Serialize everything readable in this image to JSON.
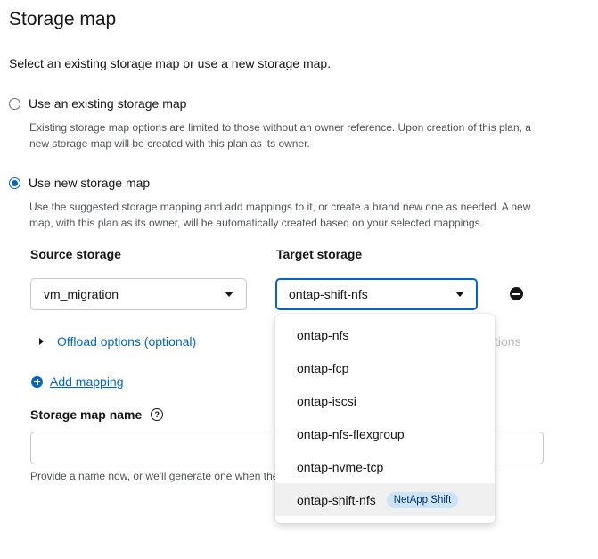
{
  "page": {
    "title": "Storage map",
    "subtitle": "Select an existing storage map or use a new storage map."
  },
  "options": {
    "existing": {
      "label": "Use an existing storage map",
      "description": "Existing storage map options are limited to those without an owner reference. Upon creation of this plan, a new storage map will be created with this plan as its owner.",
      "checked": false
    },
    "new": {
      "label": "Use new storage map",
      "description": "Use the suggested storage mapping and add mappings to it, or create a brand new one as needed. A new map, with this plan as its owner, will be automatically created based on your selected mappings.",
      "checked": true
    }
  },
  "mapping": {
    "source_label": "Source storage",
    "target_label": "Target storage",
    "source_value": "vm_migration",
    "target_value": "ontap-shift-nfs",
    "offload_label": "Offload options (optional)",
    "ghost_text": "tions",
    "add_label": "Add mapping"
  },
  "name_field": {
    "label": "Storage map name",
    "value": "",
    "helper": "Provide a name now, or we'll generate one when the"
  },
  "dropdown": {
    "items": [
      {
        "label": "ontap-nfs"
      },
      {
        "label": "ontap-fcp"
      },
      {
        "label": "ontap-iscsi"
      },
      {
        "label": "ontap-nfs-flexgroup"
      },
      {
        "label": "ontap-nvme-tcp"
      },
      {
        "label": "ontap-shift-nfs",
        "badge": "NetApp Shift"
      }
    ]
  },
  "icons": {
    "remove": "minus-circle-icon",
    "add": "plus-circle-icon",
    "help": "question-circle-icon",
    "expand": "chevron-right-icon",
    "caret": "caret-down-icon"
  },
  "colors": {
    "accent": "#0066cc",
    "badge_bg": "#cde3f8",
    "text": "#151515",
    "muted": "#4f5255"
  }
}
